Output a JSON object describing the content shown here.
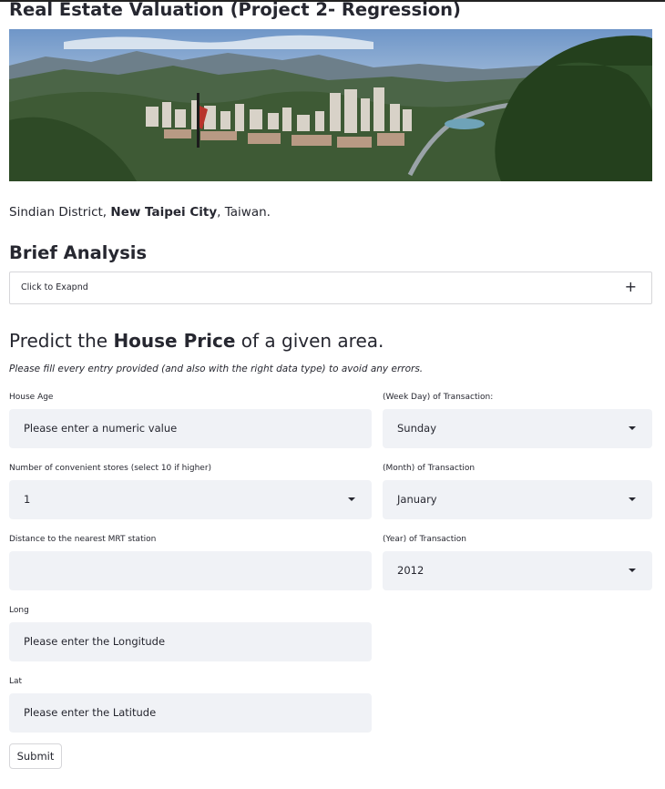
{
  "page": {
    "title": "Real Estate Valuation (Project 2- Regression)"
  },
  "banner": {
    "alt": "Sindian District city view"
  },
  "caption": {
    "part1": "Sindian District, ",
    "bold": "New Taipei City",
    "part2": ", Taiwan."
  },
  "analysis": {
    "heading": "Brief Analysis",
    "expander_label": "Click to Exapnd",
    "expander_icon": "+"
  },
  "predict": {
    "heading_part1": "Predict the ",
    "heading_bold": "House Price",
    "heading_part2": " of a given area.",
    "instructions": "Please fill every entry provided (and also with the right data type) to avoid any errors."
  },
  "form": {
    "house_age": {
      "label": "House Age",
      "placeholder": "Please enter a numeric value"
    },
    "stores": {
      "label": "Number of convenient stores (select 10 if higher)",
      "value": "1"
    },
    "mrt_distance": {
      "label": "Distance to the nearest MRT station",
      "value": ""
    },
    "longitude": {
      "label": "Long",
      "placeholder": "Please enter the Longitude"
    },
    "latitude": {
      "label": "Lat",
      "placeholder": "Please enter the Latitude"
    },
    "weekday": {
      "label": "(Week Day) of Transaction:",
      "value": "Sunday"
    },
    "month": {
      "label": "(Month) of Transaction",
      "value": "January"
    },
    "year": {
      "label": "(Year) of Transaction",
      "value": "2012"
    },
    "submit_label": "Submit"
  },
  "colors": {
    "text": "#262730",
    "field_bg": "#f0f2f6",
    "border": "#d6d6d9"
  }
}
